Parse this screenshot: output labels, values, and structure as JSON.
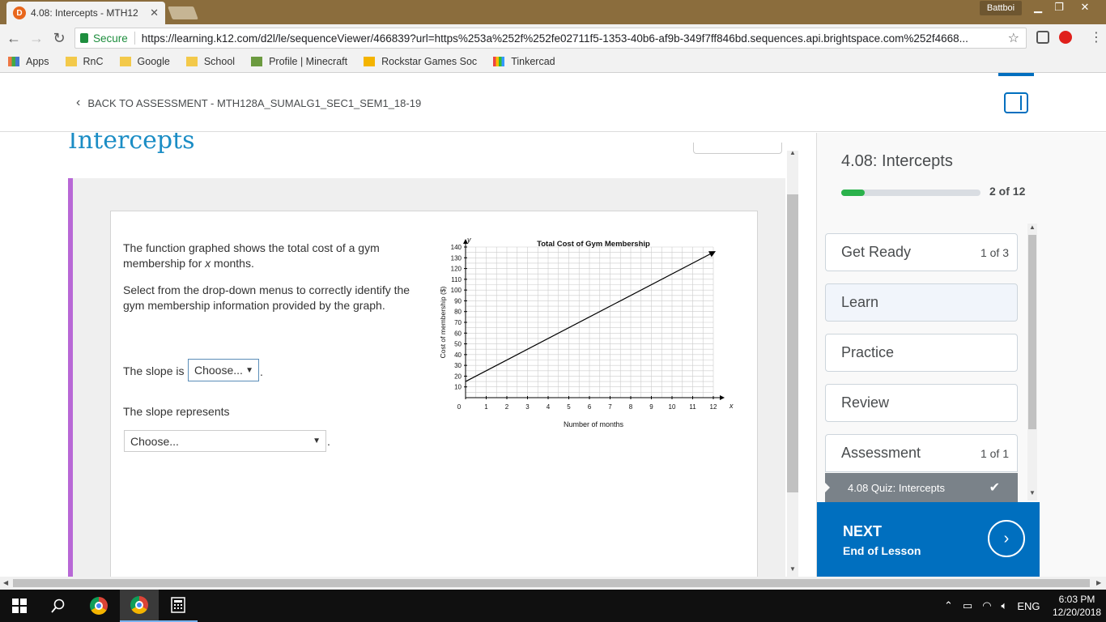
{
  "browser": {
    "tab_title": "4.08: Intercepts - MTH12",
    "tab_favicon": "D",
    "user": "Battboi",
    "secure_label": "Secure",
    "url": "https://learning.k12.com/d2l/le/sequenceViewer/466839?url=https%253a%252f%252fe02711f5-1353-40b6-af9b-349f7ff846bd.sequences.api.brightspace.com%252f4668..."
  },
  "bookmarks": [
    {
      "label": "Apps",
      "icon": "apps-icon"
    },
    {
      "label": "RnC",
      "icon": "folder-icon"
    },
    {
      "label": "Google",
      "icon": "folder-icon"
    },
    {
      "label": "School",
      "icon": "folder-icon"
    },
    {
      "label": "Profile | Minecraft",
      "icon": "minecraft-icon"
    },
    {
      "label": "Rockstar Games Soc",
      "icon": "rockstar-icon"
    },
    {
      "label": "Tinkercad",
      "icon": "tinkercad-icon"
    }
  ],
  "header": {
    "back_label": "BACK TO ASSESSMENT - MTH128A_SUMALG1_SEC1_SEM1_18-19"
  },
  "content": {
    "lesson_title": "Intercepts",
    "question": {
      "p1_a": "The function graphed shows the total cost of a gym membership for ",
      "p1_var": "x",
      "p1_b": " months.",
      "p2": "Select from the drop-down menus to correctly identify the gym membership information provided by the graph.",
      "slope_label": "The slope is",
      "slope_select": "Choose...",
      "represents_label": "The slope represents",
      "represents_select": "Choose...",
      "period": "."
    }
  },
  "chart_data": {
    "type": "line",
    "title": "Total Cost of Gym Membership",
    "xlabel": "Number of months",
    "ylabel": "Cost of membership ($)",
    "x_axis_var": "x",
    "y_axis_var": "y",
    "xlim": [
      0,
      12
    ],
    "ylim": [
      0,
      140
    ],
    "x_ticks": [
      0,
      1,
      2,
      3,
      4,
      5,
      6,
      7,
      8,
      9,
      10,
      11,
      12
    ],
    "y_ticks": [
      10,
      20,
      30,
      40,
      50,
      60,
      70,
      80,
      90,
      100,
      110,
      120,
      130,
      140
    ],
    "grid": true,
    "series": [
      {
        "x": [
          0,
          12
        ],
        "y": [
          15,
          135
        ],
        "arrow_end": true
      }
    ],
    "colors": {
      "line": "#000000",
      "grid": "#cccccc"
    }
  },
  "sidebar": {
    "title": "4.08: Intercepts",
    "progress_text": "2 of 12",
    "progress_fraction": 0.167,
    "modules": [
      {
        "label": "Get Ready",
        "count": "1 of 3"
      },
      {
        "label": "Learn",
        "count": ""
      },
      {
        "label": "Practice",
        "count": ""
      },
      {
        "label": "Review",
        "count": ""
      },
      {
        "label": "Assessment",
        "count": "1 of 1"
      }
    ],
    "quiz_item": "4.08 Quiz: Intercepts",
    "next_label": "NEXT",
    "next_sub": "End of Lesson"
  },
  "taskbar": {
    "language": "ENG",
    "time": "6:03 PM",
    "date": "12/20/2018"
  },
  "colors": {
    "accent": "#006fbf",
    "title_blue": "#1b8dc5",
    "question_border": "#b868d6",
    "progress": "#2bb24c"
  }
}
